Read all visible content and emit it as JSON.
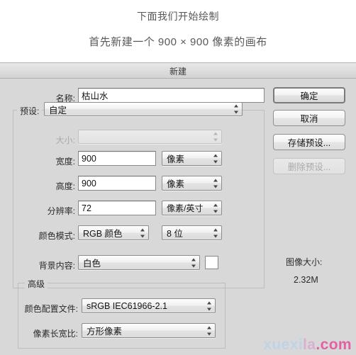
{
  "tutorial": {
    "line1": "下面我们开始绘制",
    "line2": "首先新建一个 900 × 900 像素的画布"
  },
  "dialog": {
    "title": "新建",
    "fields": {
      "name_label": "名称:",
      "name_value": "枯山水",
      "preset_label": "预设:",
      "preset_value": "自定",
      "size_label": "大小:",
      "size_value": "",
      "width_label": "宽度:",
      "width_value": "900",
      "width_unit": "像素",
      "height_label": "高度:",
      "height_value": "900",
      "height_unit": "像素",
      "resolution_label": "分辨率:",
      "resolution_value": "72",
      "resolution_unit": "像素/英寸",
      "colormode_label": "颜色模式:",
      "colormode_value": "RGB 颜色",
      "colordepth_value": "8 位",
      "background_label": "背景内容:",
      "background_value": "白色",
      "background_swatch_color": "#ffffff"
    },
    "advanced": {
      "legend": "高级",
      "profile_label": "颜色配置文件:",
      "profile_value": "sRGB IEC61966-2.1",
      "aspect_label": "像素长宽比:",
      "aspect_value": "方形像素"
    },
    "buttons": {
      "ok": "确定",
      "cancel": "取消",
      "save_preset": "存储预设...",
      "delete_preset": "删除预设..."
    },
    "image_size": {
      "label": "图像大小:",
      "value": "2.32M"
    }
  },
  "watermark": {
    "part_a": "xuexi",
    "part_b": "la",
    "part_c": ".com"
  }
}
